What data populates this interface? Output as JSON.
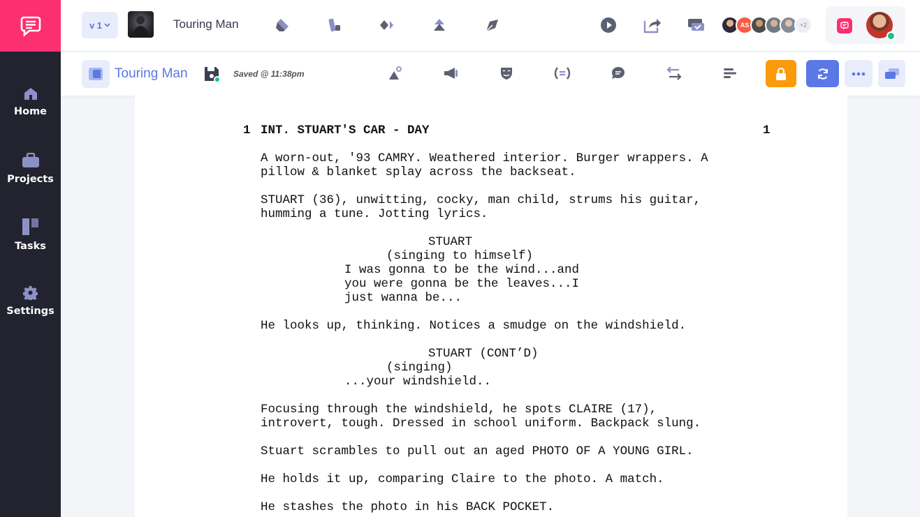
{
  "sidebar": {
    "items": [
      {
        "label": "Home",
        "icon": "home-icon"
      },
      {
        "label": "Projects",
        "icon": "briefcase-icon"
      },
      {
        "label": "Tasks",
        "icon": "kanban-icon"
      },
      {
        "label": "Settings",
        "icon": "gear-icon"
      }
    ]
  },
  "topbar": {
    "version": "v 1",
    "project_title": "Touring Man",
    "collaborators_extra": "+2",
    "avatar_initials": "AS"
  },
  "subbar": {
    "doc_title": "Touring Man",
    "saved_status": "Saved @ 11:38pm"
  },
  "script": {
    "scene_number": "1",
    "scene_heading": "INT. STUART'S CAR - DAY",
    "action_1a": "A worn-out, '93 CAMRY. Weathered interior. Burger wrappers. A",
    "action_1b": "pillow & blanket splay across the backseat.",
    "action_2a": "STUART (36), unwitting, cocky, man child, strums his guitar,",
    "action_2b": "humming a tune. Jotting lyrics.",
    "char_1": "STUART",
    "paren_1": "(singing to himself)",
    "dial_1a": "I was gonna to be the wind...and",
    "dial_1b": "you were gonna be the leaves...I",
    "dial_1c": "just wanna be...",
    "action_3": "He looks up, thinking. Notices a smudge on the windshield.",
    "char_2": "STUART (CONT’D)",
    "paren_2": "(singing)",
    "dial_2": "...your windshield..",
    "action_4a": "Focusing through the windshield, he spots CLAIRE (17),",
    "action_4b": "introvert, tough. Dressed in school uniform. Backpack slung.",
    "action_5": "Stuart scrambles to pull out an aged PHOTO OF A YOUNG GIRL.",
    "action_6": "He holds it up, comparing Claire to the photo. A match.",
    "action_7": "He stashes the photo in his BACK POCKET."
  },
  "colors": {
    "brand": "#fc2f70",
    "sidebar": "#22232e",
    "accent": "#5a78e6",
    "lock": "#fb9a0a",
    "online": "#13c38b"
  }
}
